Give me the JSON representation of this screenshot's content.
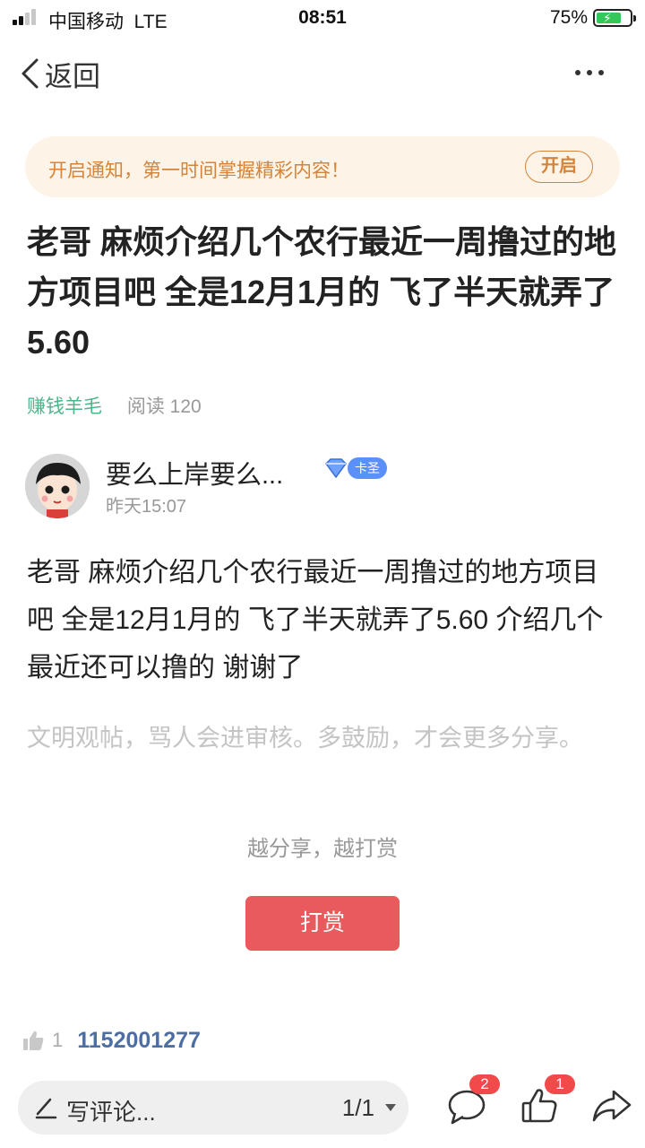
{
  "status_bar": {
    "carrier": "中国移动",
    "network": "LTE",
    "time": "08:51",
    "battery": "75%",
    "battery_level": 0.75
  },
  "nav": {
    "back_label": "返回",
    "more_icon": "more-dots-icon"
  },
  "notify_banner": {
    "text": "开启通知，第一时间掌握精彩内容！",
    "button_label": "开启"
  },
  "post": {
    "title": "老哥 麻烦介绍几个农行最近一周撸过的地方项目吧 全是12月1月的 飞了半天就弄了5.60",
    "category": "赚钱羊毛",
    "reads": "阅读 120",
    "author": {
      "name": "要么上岸要么...",
      "badge": "卡圣",
      "time": "昨天15:07"
    },
    "body": "老哥 麻烦介绍几个农行最近一周撸过的地方项目吧 全是12月1月的 飞了半天就弄了5.60 介绍几个最近还可以撸的 谢谢了",
    "notice": "文明观帖，骂人会进审核。多鼓励，才会更多分享。",
    "share_hint": "越分享，越打赏",
    "reward_label": "打赏",
    "like_count": "1",
    "liker": "1152001277"
  },
  "toolbar": {
    "comment_placeholder": "写评论...",
    "page": "1/1",
    "comment_count": "2",
    "like_count": "1"
  },
  "colors": {
    "accent_red": "#e85a5b",
    "category_green": "#4fb58a",
    "banner_orange": "#d4843a",
    "liker_blue": "#4d6ea3"
  }
}
